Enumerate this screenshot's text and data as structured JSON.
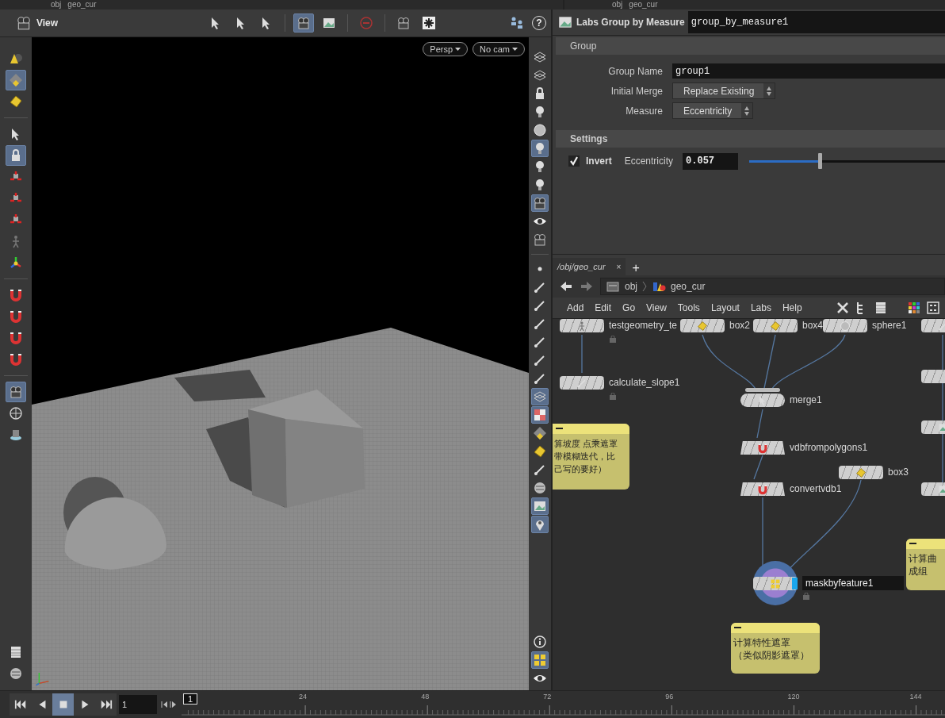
{
  "top_bar": {
    "left_path": [
      "obj",
      "geo_cur"
    ],
    "right_path": [
      "obj",
      "geo_cur"
    ]
  },
  "viewer": {
    "title": "View",
    "toolbar": [
      {
        "selected": false
      },
      {
        "selected": false
      },
      {
        "selected": false
      },
      {
        "selected": true
      },
      {
        "selected": false
      },
      {
        "selected": false
      },
      {
        "selected": false
      },
      {
        "selected": false
      },
      {
        "selected": false
      }
    ],
    "help": "?",
    "camera_menus": [
      "Persp",
      "No cam"
    ],
    "left_tools": [
      {
        "selected": false
      },
      {
        "selected": true
      },
      {
        "selected": false
      },
      {
        "selected": false
      },
      {
        "selected": true
      },
      {
        "selected": false
      },
      {
        "selected": false
      },
      {
        "selected": false
      },
      {
        "selected": false
      },
      {
        "selected": false
      },
      {
        "selected": false
      },
      {
        "selected": false
      },
      {
        "selected": false
      },
      {
        "selected": false
      },
      {
        "selected": true
      },
      {
        "selected": false
      },
      {
        "selected": false
      },
      {
        "selected": false
      },
      {
        "selected": false
      }
    ],
    "right_tools": [
      {
        "selected": false
      },
      {
        "selected": false
      },
      {
        "selected": false
      },
      {
        "selected": false
      },
      {
        "selected": false
      },
      {
        "selected": true
      },
      {
        "selected": false
      },
      {
        "selected": false
      },
      {
        "selected": true
      },
      {
        "selected": false
      },
      {
        "selected": false
      },
      {
        "selected": false
      },
      {
        "selected": false
      },
      {
        "selected": false
      },
      {
        "selected": false
      },
      {
        "selected": false
      },
      {
        "selected": false
      },
      {
        "selected": false
      },
      {
        "selected": true
      },
      {
        "selected": true
      },
      {
        "selected": false
      },
      {
        "selected": false
      },
      {
        "selected": false
      },
      {
        "selected": false
      },
      {
        "selected": true
      },
      {
        "selected": true
      },
      {
        "selected": false
      },
      {
        "selected": true
      },
      {
        "selected": false
      }
    ]
  },
  "parameters": {
    "node_type": "Labs Group by Measure",
    "node_name": "group_by_measure1",
    "sections": [
      {
        "title": "Group",
        "bold": false
      },
      {
        "title": "Settings",
        "bold": true
      }
    ],
    "rows": [
      {
        "kind": "field",
        "label": "Group Name",
        "value": "group1"
      },
      {
        "kind": "menu",
        "label": "Initial Merge",
        "value": "Replace Existing"
      },
      {
        "kind": "menu",
        "label": "Measure",
        "value": "Eccentricity"
      }
    ],
    "invert": {
      "label": "Invert",
      "checked": true
    },
    "eccentricity": {
      "label": "Eccentricity",
      "value": "0.057",
      "level": 0.36
    }
  },
  "network": {
    "tab": "/obj/geo_cur",
    "tab_close": "×",
    "tab_add": "+",
    "path": [
      "obj",
      "geo_cur"
    ],
    "menu": [
      "Add",
      "Edit",
      "Go",
      "View",
      "Tools",
      "Layout",
      "Labs",
      "Help"
    ],
    "nodes": [
      {
        "name": "testgeometry_te",
        "kind": "standard",
        "locked": true,
        "selected": false
      },
      {
        "name": "box2",
        "kind": "standard",
        "locked": false,
        "selected": false
      },
      {
        "name": "box4",
        "kind": "standard",
        "locked": false,
        "selected": false
      },
      {
        "name": "sphere1",
        "kind": "standard",
        "locked": false,
        "selected": false
      },
      {
        "name": "calculate_slope1",
        "kind": "standard",
        "locked": true,
        "selected": false
      },
      {
        "name": "merge1",
        "kind": "merge",
        "locked": false,
        "selected": false
      },
      {
        "name": "vdbfrompolygons1",
        "kind": "vdb",
        "locked": false,
        "selected": false
      },
      {
        "name": "box3",
        "kind": "standard",
        "locked": false,
        "selected": false
      },
      {
        "name": "convertvdb1",
        "kind": "vdb",
        "locked": false,
        "selected": false
      },
      {
        "name": "maskbyfeature1",
        "kind": "standard",
        "locked": true,
        "selected": true
      },
      {
        "kind": "standard",
        "locked": false,
        "selected": false
      },
      {
        "kind": "standard",
        "locked": false,
        "selected": false
      },
      {
        "kind": "standard",
        "locked": false,
        "selected": false
      },
      {
        "kind": "standard",
        "locked": false,
        "selected": false
      }
    ],
    "notes": [
      {
        "lines": [
          "算坡度 点乘遮罩",
          "带模糊迭代，比",
          "己写的要好）"
        ]
      },
      {
        "lines": [
          "计算曲",
          "成组"
        ]
      },
      {
        "lines": [
          "计算特性遮罩",
          "（类似阴影遮罩）"
        ]
      }
    ]
  },
  "timeline": {
    "controls": [
      {
        "selected": false
      },
      {
        "selected": false
      },
      {
        "selected": true
      },
      {
        "selected": false
      },
      {
        "selected": false
      }
    ],
    "frame": "1",
    "marker": "1",
    "ticks": [
      "24",
      "48",
      "72",
      "96",
      "120",
      "144"
    ]
  }
}
